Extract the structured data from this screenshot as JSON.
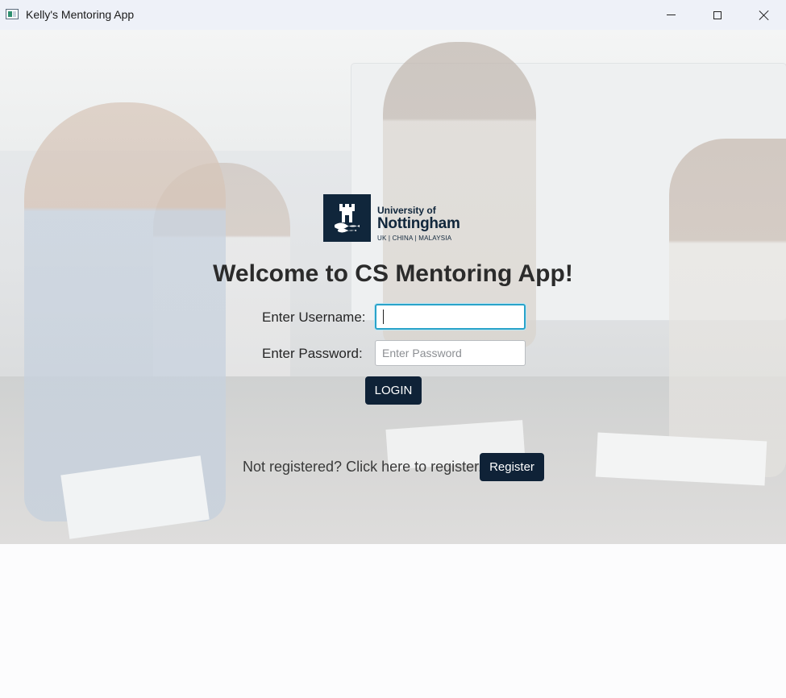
{
  "window": {
    "title": "Kelly's Mentoring App",
    "icon": "app-window-icon",
    "controls": [
      "minimize-icon",
      "maximize-icon",
      "close-icon"
    ]
  },
  "logo": {
    "line1": "University of",
    "line2": "Nottingham",
    "line3": "UK | CHINA | MALAYSIA",
    "color": "#10263b"
  },
  "login": {
    "heading": "Welcome to CS Mentoring App!",
    "username_label": "Enter Username:",
    "username_value": "",
    "username_placeholder": "",
    "password_label": "Enter Password:",
    "password_value": "",
    "password_placeholder": "Enter Password",
    "login_button": "LOGIN"
  },
  "register": {
    "prompt": "Not registered? Click here to register.",
    "button": "Register"
  },
  "colors": {
    "button_bg": "#0f2237",
    "focus_border": "#2aa3c9"
  }
}
